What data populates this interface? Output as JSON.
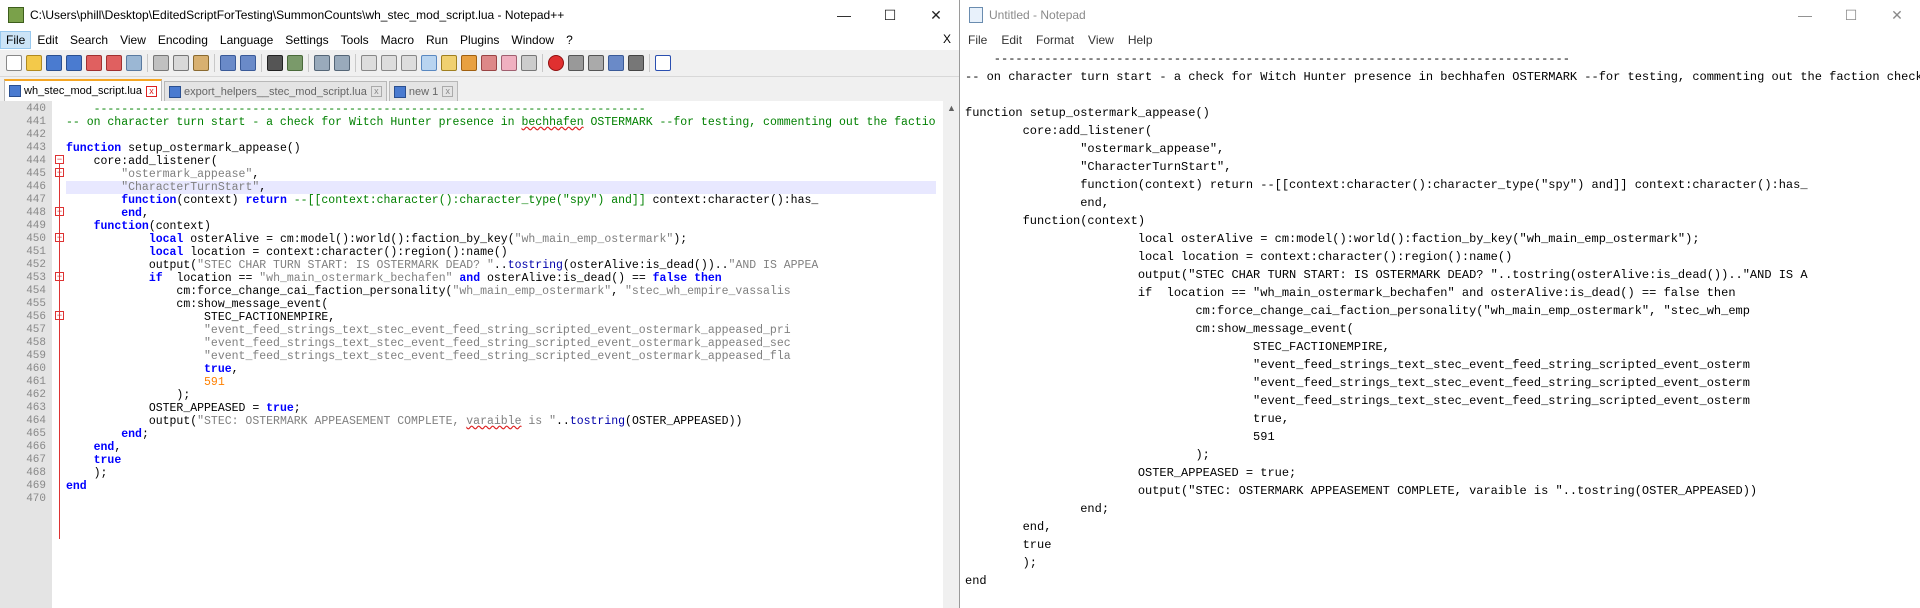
{
  "npp": {
    "title": "C:\\Users\\phill\\Desktop\\EditedScriptForTesting\\SummonCounts\\wh_stec_mod_script.lua - Notepad++",
    "menu": [
      "File",
      "Edit",
      "Search",
      "View",
      "Encoding",
      "Language",
      "Settings",
      "Tools",
      "Macro",
      "Run",
      "Plugins",
      "Window",
      "?"
    ],
    "menu_close": "X",
    "tabs": [
      {
        "label": "wh_stec_mod_script.lua",
        "active": true
      },
      {
        "label": "export_helpers__stec_mod_script.lua",
        "active": false
      },
      {
        "label": "new 1",
        "active": false
      }
    ],
    "line_numbers": [
      "440",
      "441",
      "442",
      "443",
      "444",
      "445",
      "446",
      "447",
      "448",
      "449",
      "450",
      "451",
      "452",
      "453",
      "454",
      "455",
      "456",
      "457",
      "458",
      "459",
      "460",
      "461",
      "462",
      "463",
      "464",
      "465",
      "466",
      "467",
      "468",
      "469",
      "470"
    ]
  },
  "notepad": {
    "title": "Untitled - Notepad",
    "menu": [
      "File",
      "Edit",
      "Format",
      "View",
      "Help"
    ]
  },
  "window_controls": {
    "minimize": "—",
    "maximize": "☐",
    "close": "✕"
  },
  "colors": {
    "comment": "#008000",
    "keyword": "#0000ff",
    "string": "#808080",
    "number": "#ff8000",
    "active_tab_accent": "#f5a623"
  }
}
